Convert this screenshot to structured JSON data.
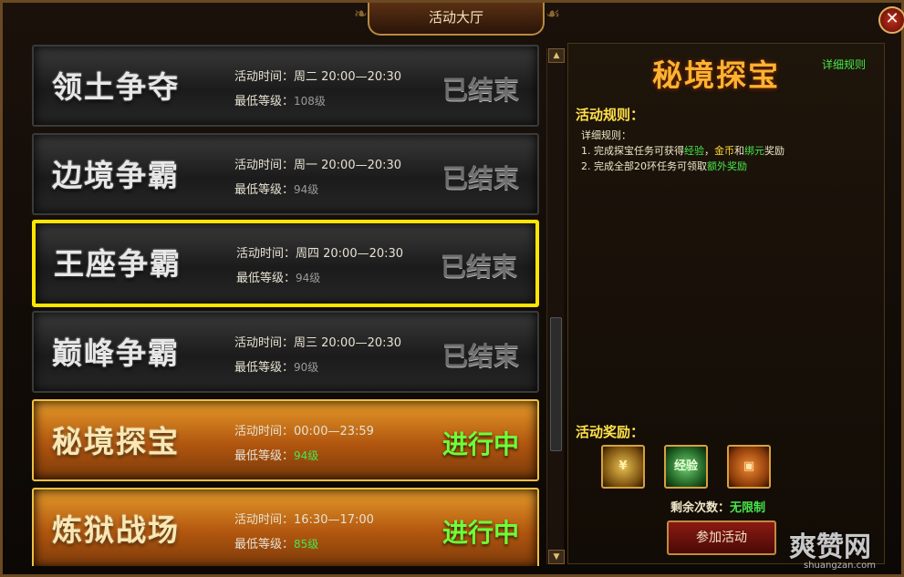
{
  "window": {
    "title": "活动大厅",
    "close_label": "✕"
  },
  "activities": [
    {
      "name": "领土争夺",
      "time": "活动时间：周二 20:00—20:30",
      "level_label": "最低等级：",
      "level": "108级",
      "state": "已结束"
    },
    {
      "name": "边境争霸",
      "time": "活动时间：周一 20:00—20:30",
      "level_label": "最低等级：",
      "level": "94级",
      "state": "已结束"
    },
    {
      "name": "王座争霸",
      "time": "活动时间：周四 20:00—20:30",
      "level_label": "最低等级：",
      "level": "94级",
      "state": "已结束"
    },
    {
      "name": "巅峰争霸",
      "time": "活动时间：周三 20:00—20:30",
      "level_label": "最低等级：",
      "level": "90级",
      "state": "已结束"
    },
    {
      "name": "秘境探宝",
      "time": "活动时间：00:00—23:59",
      "level_label": "最低等级：",
      "level": "94级",
      "state": "进行中"
    },
    {
      "name": "炼狱战场",
      "time": "活动时间：16:30—17:00",
      "level_label": "最低等级：",
      "level": "85级",
      "state": "进行中"
    }
  ],
  "detail": {
    "title": "秘境探宝",
    "detail_link": "详细规则",
    "rules_head": "活动规则：",
    "rules_sub": "详细规则：",
    "rule1": {
      "prefix": "1. 完成探宝任务可获得",
      "exp": "经验",
      "sep1": "，",
      "gold": "金币",
      "and": "和",
      "bind": "绑元",
      "suffix": "奖励"
    },
    "rule2": {
      "prefix": "2. 完成全部20环任务可领取",
      "extra": "额外奖励"
    },
    "reward_head": "活动奖励：",
    "rewards": [
      {
        "icon": "gold-coin-icon",
        "label": "¥"
      },
      {
        "icon": "exp-orb-icon",
        "label": "经验"
      },
      {
        "icon": "treasure-chest-icon",
        "label": "▣"
      }
    ],
    "remain_label": "剩余次数：",
    "remain_value": "无限制",
    "join_label": "参加活动"
  },
  "watermark": {
    "text": "爽赞网",
    "url": "shuangzan.com"
  },
  "colors": {
    "active_green": "#46e84a",
    "gold_title": "#ffb230",
    "selected_border": "#ffe600"
  }
}
